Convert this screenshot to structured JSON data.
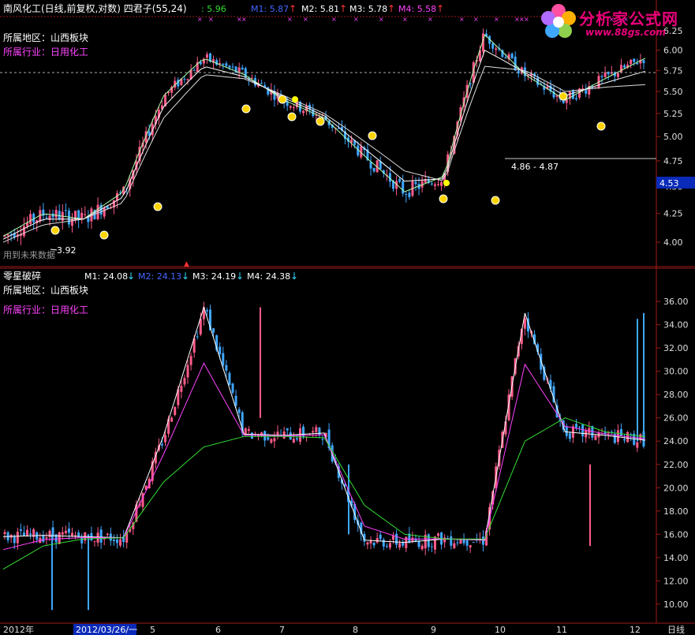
{
  "top": {
    "title": "南风化工(日线,前复权,对数) 四君子(55,24)",
    "m_first_value": ": 5.96",
    "m_values": [
      {
        "label": "M1: 5.87",
        "color": "#4466ff",
        "arrow": "up"
      },
      {
        "label": "M2: 5.81",
        "color": "#ffffff",
        "arrow": "up"
      },
      {
        "label": "M3: 5.78",
        "color": "#ffffff",
        "arrow": "up"
      },
      {
        "label": "M4: 5.58",
        "color": "#ff44ff",
        "arrow": "up"
      }
    ],
    "region_label": "所属地区：山西板块",
    "industry_label": "所属行业：日用化工",
    "ticks": [
      "6.25",
      "6.00",
      "5.75",
      "5.50",
      "5.25",
      "5.00",
      "4.75",
      "4.50",
      "4.25",
      "4.00"
    ],
    "tick_values": [
      6.25,
      6.0,
      5.75,
      5.5,
      5.25,
      5.0,
      4.75,
      4.5,
      4.25,
      4.0
    ],
    "current_price": "4.53",
    "annotation_range": "4.86 - 4.87",
    "annotation_low": "3.92",
    "future_note": "用到未来数据"
  },
  "bottom": {
    "title": "零星破碎",
    "m_values": [
      {
        "label": "M1: 24.08",
        "color": "#ffffff",
        "arrow": "down"
      },
      {
        "label": "M2: 24.13",
        "color": "#4466ff",
        "arrow": "down"
      },
      {
        "label": "M3: 24.19",
        "color": "#ffffff",
        "arrow": "down"
      },
      {
        "label": "M4: 24.38",
        "color": "#ffffff",
        "arrow": "down"
      }
    ],
    "region_label": "所属地区：山西板块",
    "industry_label": "所属行业：日用化工",
    "ticks": [
      "36.00",
      "34.00",
      "32.00",
      "30.00",
      "28.00",
      "26.00",
      "24.00",
      "22.00",
      "20.00",
      "18.00",
      "16.00",
      "14.00",
      "12.00",
      "10.00"
    ],
    "tick_values": [
      36,
      34,
      32,
      30,
      28,
      26,
      24,
      22,
      20,
      18,
      16,
      14,
      12,
      10
    ]
  },
  "x_axis": {
    "labels": [
      "2012年",
      "2012/03/26/一",
      "5",
      "6",
      "7",
      "8",
      "9",
      "10",
      "11",
      "12"
    ],
    "period": "日线"
  },
  "colors": {
    "up": "#ff5c8a",
    "down": "#3fa7ff",
    "ma_white": "#ffffff",
    "ma_green": "#33dd33",
    "ma_magenta": "#ff44ff",
    "grid": "#9b1a1a",
    "axis_text": "#dddddd"
  },
  "logo": {
    "name": "分析家公式网",
    "url": "www.88gs.com"
  },
  "chart_data": [
    {
      "type": "line",
      "title": "南风化工(日线,前复权,对数) 四君子(55,24)",
      "x": [
        "2012年",
        "2012/03/26",
        "5",
        "6",
        "7",
        "8",
        "9",
        "10",
        "11",
        "12"
      ],
      "series": [
        {
          "name": "M1",
          "values": [
            4.05,
            4.25,
            4.2,
            4.45,
            5.45,
            5.9,
            5.7,
            5.4,
            5.2,
            4.8,
            4.45,
            4.6,
            6.2,
            5.7,
            5.4,
            5.65,
            5.9
          ]
        },
        {
          "name": "M4",
          "values": [
            4.0,
            4.15,
            4.2,
            4.35,
            5.2,
            5.7,
            5.65,
            5.45,
            5.25,
            4.95,
            4.65,
            4.55,
            5.8,
            5.75,
            5.5,
            5.55,
            5.58
          ]
        }
      ],
      "ylim": [
        3.85,
        6.4
      ],
      "log_scale": true
    },
    {
      "type": "line",
      "title": "零星破碎",
      "x": [
        "2012年",
        "2012/03/26",
        "5",
        "6",
        "7",
        "8",
        "9",
        "10",
        "11",
        "12"
      ],
      "series": [
        {
          "name": "M1",
          "values": [
            15.8,
            15.9,
            15.8,
            15.7,
            24.5,
            35.5,
            24.6,
            24.5,
            24.7,
            15.5,
            15.3,
            15.6,
            15.5,
            35.0,
            24.8,
            24.5,
            24.08
          ]
        },
        {
          "name": "M4",
          "values": [
            13.0,
            15.0,
            15.6,
            15.7,
            20.5,
            23.5,
            24.4,
            24.4,
            24.3,
            18.5,
            16.0,
            15.6,
            15.6,
            24.0,
            26.0,
            24.8,
            24.38
          ]
        }
      ],
      "ylim": [
        8.5,
        37.5
      ]
    }
  ]
}
